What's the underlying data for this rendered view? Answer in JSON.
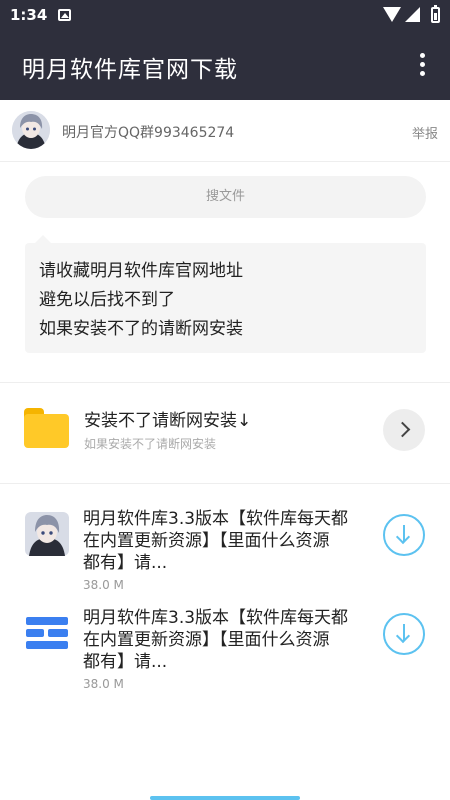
{
  "status_bar": {
    "time": "1:34",
    "icons": [
      "image-icon",
      "wifi-icon",
      "signal-icon",
      "battery-icon"
    ]
  },
  "app_bar": {
    "title": "明月软件库官网下载",
    "menu_icon": "more-vert-icon"
  },
  "author": {
    "avatar_icon": "anime-avatar",
    "name": "明月官方QQ群993465274",
    "report_label": "举报"
  },
  "search": {
    "placeholder": "搜文件"
  },
  "notice": {
    "lines": [
      "请收藏明月软件库官网地址",
      "避免以后找不到了",
      "如果安装不了的请断网安装"
    ]
  },
  "folder": {
    "icon": "folder-icon",
    "title": "安装不了请断网安装↓",
    "subtitle": "如果安装不了请断网安装",
    "action_icon": "chevron-right-icon"
  },
  "files": [
    {
      "icon": "anime-avatar",
      "title_line1": "明月软件库3.3版本【软件库每天都",
      "title_line2": "在内置更新资源】【里面什么资源",
      "title_line3": "都有】请...",
      "size": "38.0 M",
      "action_icon": "download-icon"
    },
    {
      "icon": "blue-app-icon",
      "title_line1": "明月软件库3.3版本【软件库每天都",
      "title_line2": "在内置更新资源】【里面什么资源",
      "title_line3": "都有】请...",
      "size": "38.0 M",
      "action_icon": "download-icon"
    }
  ],
  "colors": {
    "app_bar": "#2e2f3c",
    "accent": "#5cc2f0",
    "folder": "#ffc928"
  }
}
